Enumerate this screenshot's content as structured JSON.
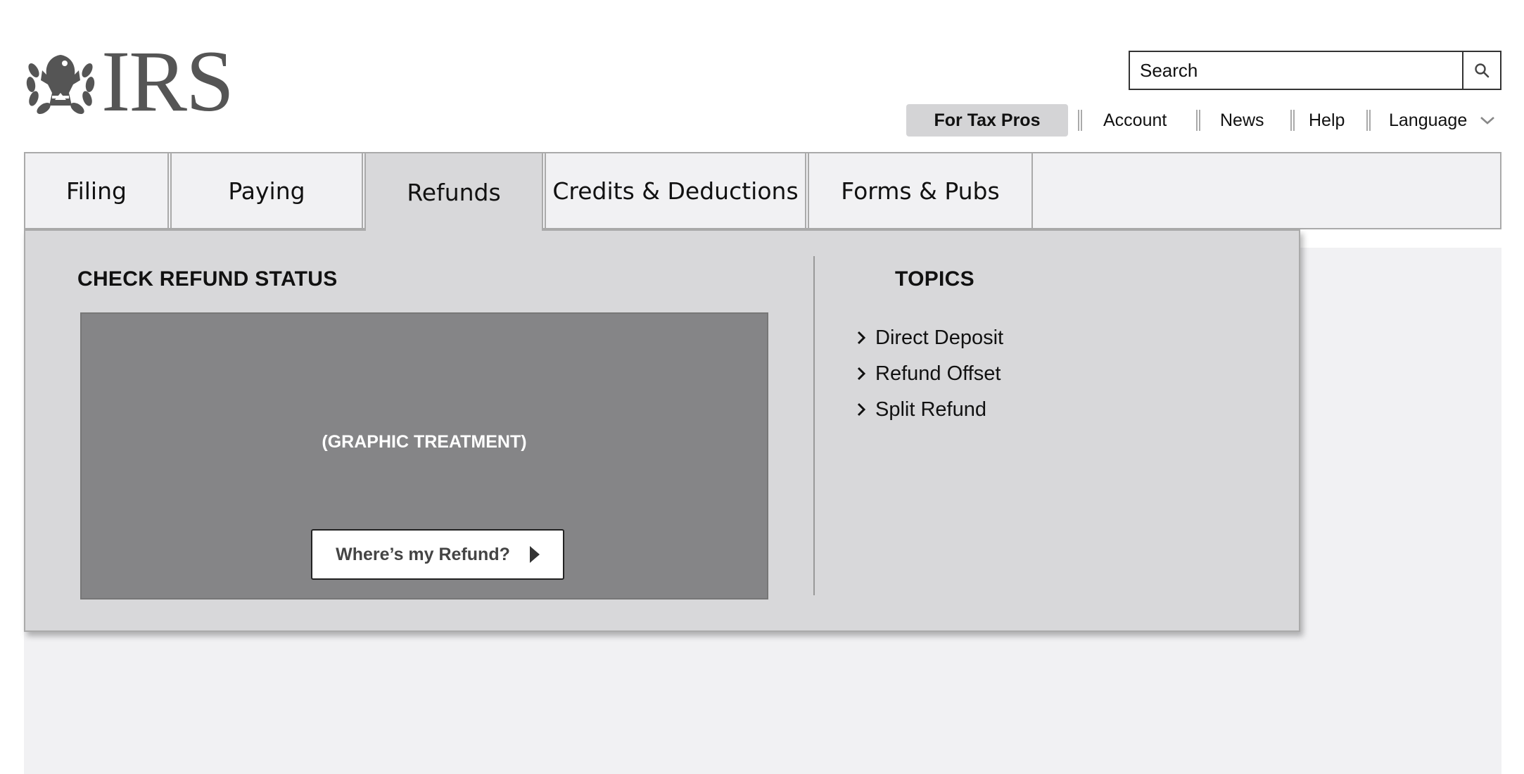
{
  "logo": {
    "text": "IRS"
  },
  "search": {
    "placeholder": "Search"
  },
  "utility_nav": {
    "pro": "For Tax Pros",
    "account": "Account",
    "news": "News",
    "help": "Help",
    "language": "Language"
  },
  "main_nav": {
    "tabs": [
      {
        "label": "Filing"
      },
      {
        "label": "Paying"
      },
      {
        "label": "Refunds",
        "active": true
      },
      {
        "label": "Credits & Deductions"
      },
      {
        "label": "Forms & Pubs"
      }
    ]
  },
  "dropdown": {
    "left": {
      "heading": "CHECK REFUND STATUS",
      "graphic_label": "(GRAPHIC TREATMENT)",
      "button_label": "Where’s my Refund?"
    },
    "right": {
      "heading": "TOPICS",
      "items": [
        {
          "label": "Direct Deposit"
        },
        {
          "label": "Refund Offset"
        },
        {
          "label": "Split Refund"
        }
      ]
    }
  },
  "colors": {
    "panel": "#d8d8da",
    "graphic": "#858587",
    "background": "#f1f1f3"
  }
}
